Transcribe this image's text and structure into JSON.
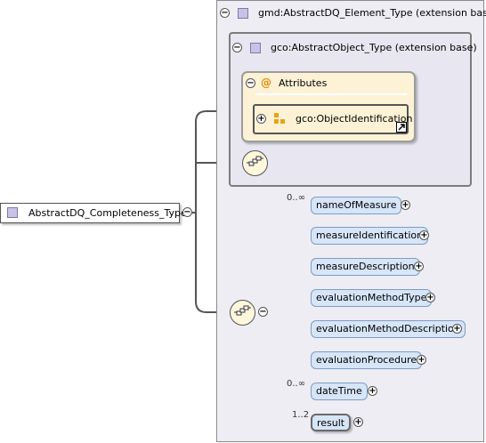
{
  "root": {
    "label": "AbstractDQ_Completeness_Type"
  },
  "ext_outer": {
    "label": "gmd:AbstractDQ_Element_Type (extension base)"
  },
  "ext_inner": {
    "label": "gco:AbstractObject_Type (extension base)"
  },
  "attributes": {
    "label": "Attributes",
    "item": "gco:ObjectIdentification"
  },
  "elements": [
    {
      "label": "nameOfMeasure",
      "card": "0..∞"
    },
    {
      "label": "measureIdentification",
      "card": ""
    },
    {
      "label": "measureDescription",
      "card": ""
    },
    {
      "label": "evaluationMethodType",
      "card": ""
    },
    {
      "label": "evaluationMethodDescription",
      "card": ""
    },
    {
      "label": "evaluationProcedure",
      "card": ""
    },
    {
      "label": "dateTime",
      "card": "0..∞"
    },
    {
      "label": "result",
      "card": "1..2"
    }
  ],
  "colors": {
    "element_fill": "#d6e5f7",
    "attribute_fill": "#fdf2d6",
    "extension_fill": "#efedf4"
  },
  "icons": [
    "collapse-icon",
    "expand-icon",
    "type-icon",
    "at-icon",
    "sequence-icon",
    "link-arrow-icon"
  ]
}
